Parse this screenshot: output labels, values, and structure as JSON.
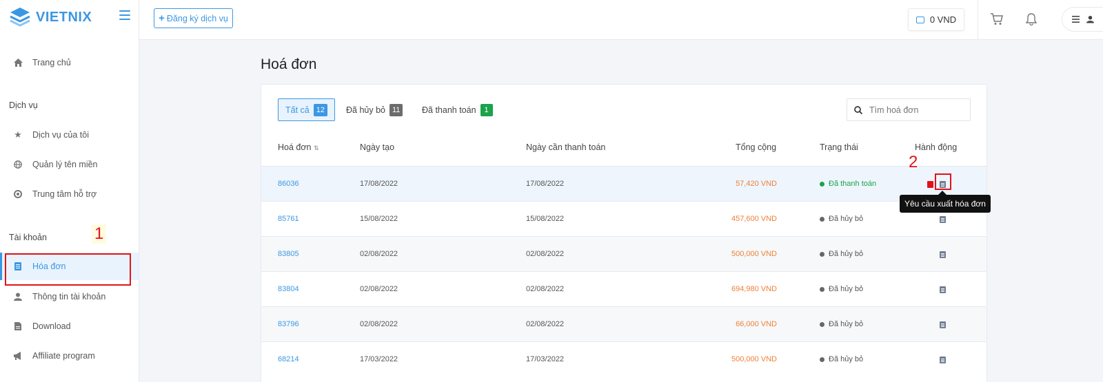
{
  "brand": {
    "name": "VIETNIX"
  },
  "sidebar": {
    "home": "Trang chủ",
    "sections": {
      "services": "Dịch vụ",
      "account": "Tài khoản"
    },
    "items": [
      {
        "label": "Dịch vụ của tôi",
        "icon": "star-icon"
      },
      {
        "label": "Quản lý tên miền",
        "icon": "globe-icon"
      },
      {
        "label": "Trung tâm hỗ trợ",
        "icon": "support-icon"
      },
      {
        "label": "Hóa đơn",
        "icon": "invoice-icon",
        "active": true
      },
      {
        "label": "Thông tin tài khoản",
        "icon": "user-icon"
      },
      {
        "label": "Download",
        "icon": "file-icon"
      },
      {
        "label": "Affiliate program",
        "icon": "megaphone-icon"
      }
    ]
  },
  "topbar": {
    "register_button": "Đăng ký dịch vụ",
    "balance": "0 VND"
  },
  "page": {
    "title": "Hoá đơn"
  },
  "filters": [
    {
      "label": "Tất cả",
      "count": "12"
    },
    {
      "label": "Đã hủy bỏ",
      "count": "11"
    },
    {
      "label": "Đã thanh toán",
      "count": "1"
    }
  ],
  "search": {
    "placeholder": "Tìm hoá đơn"
  },
  "table": {
    "headers": [
      "Hoá đơn",
      "Ngày tạo",
      "Ngày cần thanh toán",
      "Tổng cộng",
      "Trạng thái",
      "Hành động"
    ],
    "rows": [
      {
        "id": "86036",
        "created": "17/08/2022",
        "due": "17/08/2022",
        "total": "57,420 VND",
        "status": "Đã thanh toán"
      },
      {
        "id": "85761",
        "created": "15/08/2022",
        "due": "15/08/2022",
        "total": "457,600 VND",
        "status": "Đã hủy bỏ"
      },
      {
        "id": "83805",
        "created": "02/08/2022",
        "due": "02/08/2022",
        "total": "500,000 VND",
        "status": "Đã hủy bỏ"
      },
      {
        "id": "83804",
        "created": "02/08/2022",
        "due": "02/08/2022",
        "total": "694,980 VND",
        "status": "Đã hủy bỏ"
      },
      {
        "id": "83796",
        "created": "02/08/2022",
        "due": "02/08/2022",
        "total": "66,000 VND",
        "status": "Đã hủy bỏ"
      },
      {
        "id": "68214",
        "created": "17/03/2022",
        "due": "17/03/2022",
        "total": "500,000 VND",
        "status": "Đã hủy bỏ"
      }
    ]
  },
  "tooltip": {
    "text": "Yêu cầu xuất hóa đơn"
  },
  "annotations": {
    "one": "1",
    "two": "2"
  },
  "colors": {
    "accent": "#3b97e3",
    "highlight": "#e2121a",
    "amount": "#ef7f36",
    "paid": "#1aa34a"
  }
}
